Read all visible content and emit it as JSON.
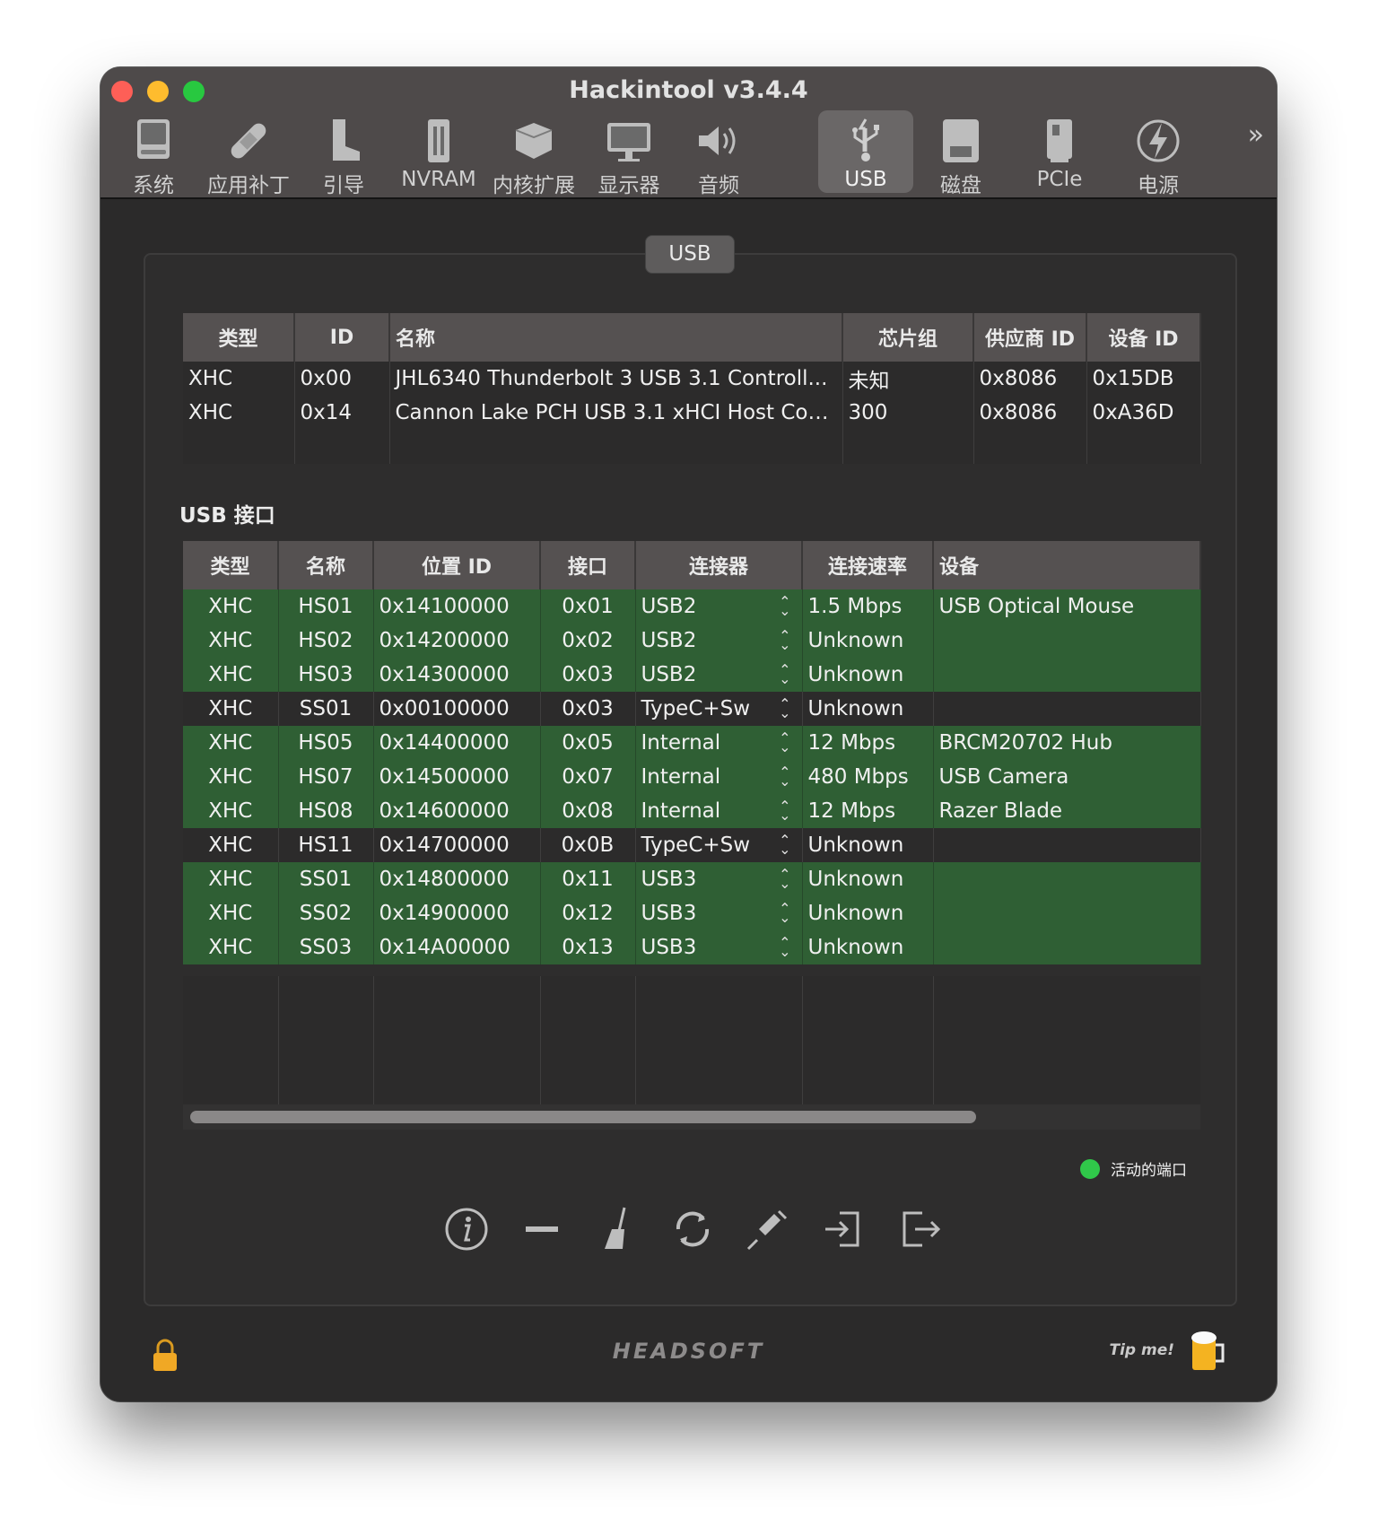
{
  "window": {
    "title": "Hackintool v3.4.4"
  },
  "toolbar": {
    "items": [
      {
        "label": "系统",
        "icon": "computer-icon"
      },
      {
        "label": "应用补丁",
        "icon": "bandage-icon"
      },
      {
        "label": "引导",
        "icon": "boot-icon"
      },
      {
        "label": "NVRAM",
        "icon": "memory-icon"
      },
      {
        "label": "内核扩展",
        "icon": "kext-icon"
      },
      {
        "label": "显示器",
        "icon": "display-icon"
      },
      {
        "label": "音频",
        "icon": "speaker-icon"
      },
      {
        "label": "USB",
        "icon": "usb-icon",
        "active": true
      },
      {
        "label": "磁盘",
        "icon": "disk-icon"
      },
      {
        "label": "PCIe",
        "icon": "pcie-icon"
      },
      {
        "label": "电源",
        "icon": "power-icon"
      }
    ],
    "more": "»"
  },
  "panel_tab": "USB",
  "controllers": {
    "headers": [
      "类型",
      "ID",
      "名称",
      "芯片组",
      "供应商 ID",
      "设备 ID"
    ],
    "rows": [
      [
        "XHC",
        "0x00",
        "JHL6340 Thunderbolt 3 USB 3.1 Controll...",
        "未知",
        "0x8086",
        "0x15DB"
      ],
      [
        "XHC",
        "0x14",
        "Cannon Lake PCH USB 3.1 xHCI Host Con...",
        "300",
        "0x8086",
        "0xA36D"
      ]
    ]
  },
  "ports_title": "USB 接口",
  "ports": {
    "headers": [
      "类型",
      "名称",
      "位置 ID",
      "接口",
      "连接器",
      "连接速率",
      "设备"
    ],
    "rows": [
      {
        "active": true,
        "cells": [
          "XHC",
          "HS01",
          "0x14100000",
          "0x01",
          "USB2",
          "1.5 Mbps",
          "USB Optical Mouse"
        ]
      },
      {
        "active": true,
        "cells": [
          "XHC",
          "HS02",
          "0x14200000",
          "0x02",
          "USB2",
          "Unknown",
          ""
        ]
      },
      {
        "active": true,
        "cells": [
          "XHC",
          "HS03",
          "0x14300000",
          "0x03",
          "USB2",
          "Unknown",
          ""
        ]
      },
      {
        "active": false,
        "cells": [
          "XHC",
          "SS01",
          "0x00100000",
          "0x03",
          "TypeC+Sw",
          "Unknown",
          ""
        ]
      },
      {
        "active": true,
        "cells": [
          "XHC",
          "HS05",
          "0x14400000",
          "0x05",
          "Internal",
          "12 Mbps",
          "BRCM20702 Hub"
        ]
      },
      {
        "active": true,
        "cells": [
          "XHC",
          "HS07",
          "0x14500000",
          "0x07",
          "Internal",
          "480 Mbps",
          "USB Camera"
        ]
      },
      {
        "active": true,
        "cells": [
          "XHC",
          "HS08",
          "0x14600000",
          "0x08",
          "Internal",
          "12 Mbps",
          "Razer Blade"
        ]
      },
      {
        "active": false,
        "cells": [
          "XHC",
          "HS11",
          "0x14700000",
          "0x0B",
          "TypeC+Sw",
          "Unknown",
          ""
        ]
      },
      {
        "active": true,
        "cells": [
          "XHC",
          "SS01",
          "0x14800000",
          "0x11",
          "USB3",
          "Unknown",
          ""
        ]
      },
      {
        "active": true,
        "cells": [
          "XHC",
          "SS02",
          "0x14900000",
          "0x12",
          "USB3",
          "Unknown",
          ""
        ]
      },
      {
        "active": true,
        "cells": [
          "XHC",
          "SS03",
          "0x14A00000",
          "0x13",
          "USB3",
          "Unknown",
          ""
        ]
      }
    ]
  },
  "legend": {
    "label": "活动的端口",
    "color": "#30c84a"
  },
  "actions": [
    "info-icon",
    "minus-icon",
    "broom-icon",
    "refresh-icon",
    "syringe-icon",
    "import-icon",
    "export-icon"
  ],
  "footer": {
    "brand": "HEADSOFT",
    "tip": "Tip me!"
  },
  "colors": {
    "active_row": "#2f5f34",
    "accent_close": "#fe5f57",
    "accent_min": "#febc2e",
    "accent_max": "#28c840"
  }
}
